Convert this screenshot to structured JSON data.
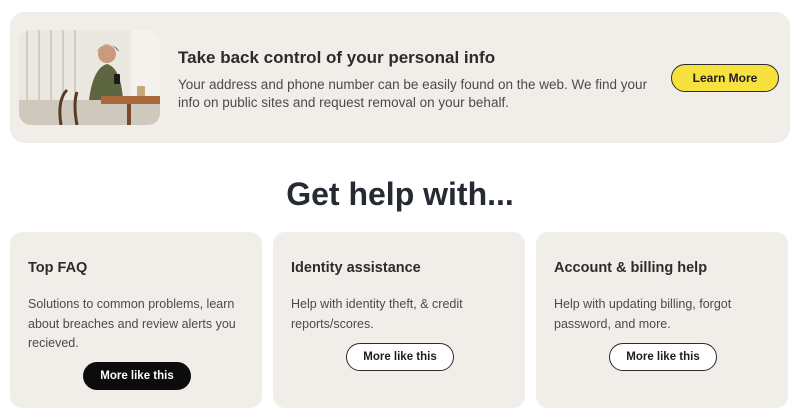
{
  "banner": {
    "image_alt": "woman-using-phone-photo",
    "title": "Take back control of your personal info",
    "text": "Your address and phone number can be easily found on the web. We find your info on public sites and request removal on your behalf.",
    "button_label": "Learn More",
    "button_color": "#f6e13f"
  },
  "help": {
    "heading": "Get help with...",
    "cards": [
      {
        "title": "Top FAQ",
        "description": "Solutions to common problems, learn about breaches and review alerts you recieved.",
        "button_label": "More like this"
      },
      {
        "title": "Identity assistance",
        "description": "Help with identity theft, & credit reports/scores.",
        "button_label": "More like this"
      },
      {
        "title": "Account & billing help",
        "description": "Help with updating billing, forgot password, and more.",
        "button_label": "More like this"
      }
    ]
  },
  "colors": {
    "panel_background": "#f1eee9",
    "heading_text": "#262a33",
    "dark_button": "#0c0c0c"
  }
}
